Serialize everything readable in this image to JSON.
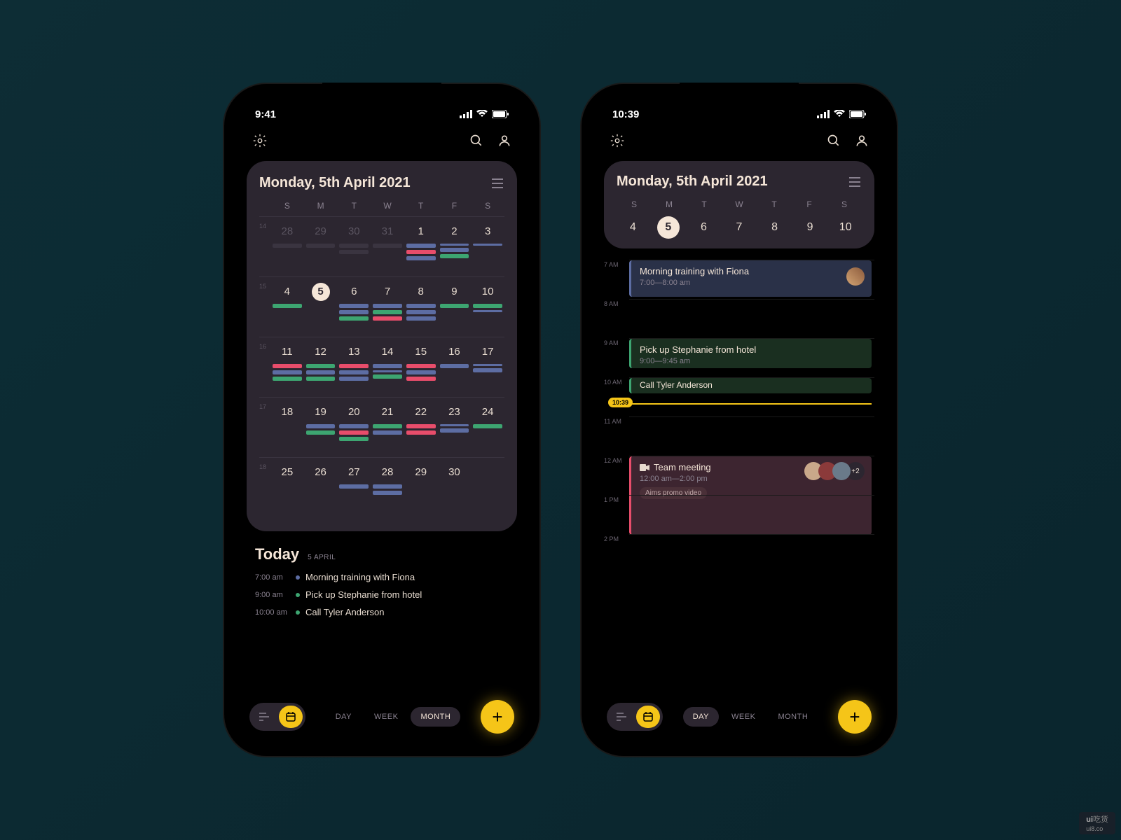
{
  "left": {
    "statusTime": "9:41",
    "title": "Monday, 5th April 2021",
    "weekdays": [
      "S",
      "M",
      "T",
      "W",
      "T",
      "F",
      "S"
    ],
    "weeks": [
      {
        "num": "14",
        "days": [
          {
            "n": "28",
            "dim": true
          },
          {
            "n": "29",
            "dim": true
          },
          {
            "n": "30",
            "dim": true
          },
          {
            "n": "31",
            "dim": true
          },
          {
            "n": "1"
          },
          {
            "n": "2"
          },
          {
            "n": "3"
          }
        ]
      },
      {
        "num": "15",
        "days": [
          {
            "n": "4"
          },
          {
            "n": "5",
            "today": true
          },
          {
            "n": "6"
          },
          {
            "n": "7"
          },
          {
            "n": "8"
          },
          {
            "n": "9"
          },
          {
            "n": "10"
          }
        ]
      },
      {
        "num": "16",
        "days": [
          {
            "n": "11"
          },
          {
            "n": "12"
          },
          {
            "n": "13"
          },
          {
            "n": "14"
          },
          {
            "n": "15"
          },
          {
            "n": "16"
          },
          {
            "n": "17"
          }
        ]
      },
      {
        "num": "17",
        "days": [
          {
            "n": "18"
          },
          {
            "n": "19"
          },
          {
            "n": "20"
          },
          {
            "n": "21"
          },
          {
            "n": "22"
          },
          {
            "n": "23"
          },
          {
            "n": "24"
          }
        ]
      },
      {
        "num": "18",
        "days": [
          {
            "n": "25"
          },
          {
            "n": "26"
          },
          {
            "n": "27"
          },
          {
            "n": "28"
          },
          {
            "n": "29"
          },
          {
            "n": "30"
          },
          {
            "n": ""
          }
        ]
      }
    ],
    "todayLabel": "Today",
    "todayDate": "5 APRIL",
    "todayItems": [
      {
        "time": "7:00 am",
        "color": "#5d6da3",
        "text": "Morning training with Fiona"
      },
      {
        "time": "9:00 am",
        "color": "#3da571",
        "text": "Pick up Stephanie from hotel"
      },
      {
        "time": "10:00 am",
        "color": "#3da571",
        "text": "Call Tyler Anderson"
      }
    ],
    "views": [
      "DAY",
      "WEEK",
      "MONTH"
    ],
    "activeView": "MONTH"
  },
  "right": {
    "statusTime": "10:39",
    "title": "Monday, 5th April 2021",
    "weekdays": [
      "S",
      "M",
      "T",
      "W",
      "T",
      "F",
      "S"
    ],
    "stripDays": [
      {
        "n": "4"
      },
      {
        "n": "5",
        "today": true
      },
      {
        "n": "6"
      },
      {
        "n": "7"
      },
      {
        "n": "8"
      },
      {
        "n": "9"
      },
      {
        "n": "10"
      }
    ],
    "hours": [
      "7 AM",
      "8 AM",
      "9 AM",
      "10 AM",
      "11 AM",
      "12 AM",
      "1 PM",
      "2 PM"
    ],
    "events": [
      {
        "title": "Morning training with Fiona",
        "time": "7:00—8:00 am",
        "class": "evt-blue",
        "hasAvatar": true
      },
      {
        "title": "Pick up Stephanie from hotel",
        "time": "9:00—9:45 am",
        "class": "evt-green"
      },
      {
        "title": "Call Tyler Anderson",
        "time": "",
        "class": "evt-green"
      },
      {
        "title": "Team meeting",
        "time": "12:00 am—2:00 pm",
        "class": "evt-pink",
        "video": true,
        "avatars": 3,
        "extra": "+2",
        "tag": "Aims promo video"
      }
    ],
    "nowTime": "10:39",
    "views": [
      "DAY",
      "WEEK",
      "MONTH"
    ],
    "activeView": "DAY"
  },
  "watermark": {
    "brand": "ui",
    "rest": "吃货",
    "sub": "ui8.co"
  }
}
